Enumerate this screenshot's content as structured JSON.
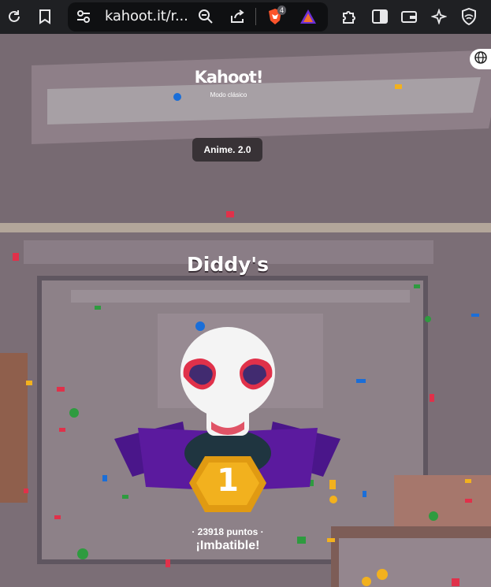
{
  "browser": {
    "url": "kahoot.it/r...",
    "brave_shields_count": "4",
    "icons": [
      "reload-icon",
      "bookmark-icon",
      "site-settings-icon",
      "zoom-out-icon",
      "share-icon",
      "brave-shields-icon",
      "brave-rewards-icon",
      "extensions-icon",
      "sidebar-icon",
      "wallet-icon",
      "leo-ai-icon",
      "vpn-icon"
    ]
  },
  "game": {
    "logo": "Kahoot!",
    "mode": "Modo clásico",
    "quiz_title": "Anime. 2.0",
    "nickname": "Diddy's",
    "rank": "1",
    "points": "· 23918 puntos ·",
    "status": "¡Imbatible!",
    "language_icon": "globe-icon"
  },
  "colors": {
    "toolbar": "#1f2023",
    "medal": "#f2b11e",
    "ribbon": "#5b1a9e",
    "glasses": "#e0314a"
  }
}
